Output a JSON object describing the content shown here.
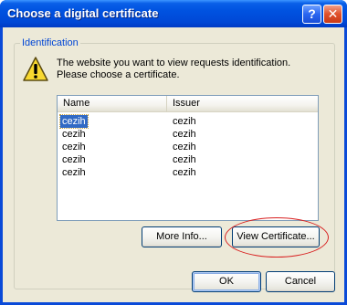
{
  "window": {
    "title": "Choose a digital certificate",
    "help_glyph": "?",
    "close_glyph": "✕"
  },
  "group": {
    "legend": "Identification"
  },
  "message": {
    "line1": "The website you want to view requests identification.",
    "line2": "Please choose a certificate."
  },
  "list": {
    "columns": [
      "Name",
      "Issuer"
    ],
    "rows": [
      {
        "name": "cezih",
        "issuer": "cezih"
      },
      {
        "name": "cezih",
        "issuer": "cezih"
      },
      {
        "name": "cezih",
        "issuer": "cezih"
      },
      {
        "name": "cezih",
        "issuer": "cezih"
      },
      {
        "name": "cezih",
        "issuer": "cezih"
      }
    ],
    "selected_index": 0
  },
  "buttons": {
    "more_info": "More Info...",
    "view_certificate": "View Certificate...",
    "ok": "OK",
    "cancel": "Cancel"
  },
  "icons": {
    "warning": "warning-icon",
    "help": "help-icon",
    "close": "close-icon"
  },
  "colors": {
    "titlebar": "#0052e0",
    "dialog_bg": "#ece9d8",
    "group_legend": "#0046d5",
    "selection": "#316ac5",
    "annotation": "#d82020"
  }
}
